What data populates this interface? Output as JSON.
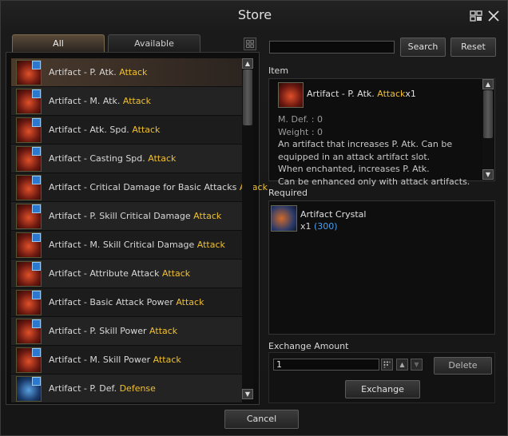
{
  "window": {
    "title": "Store"
  },
  "tabs": [
    {
      "label": "All"
    },
    {
      "label": "Available"
    }
  ],
  "items": [
    {
      "name": "Artifact - P. Atk.",
      "tag": "Attack"
    },
    {
      "name": "Artifact - M. Atk.",
      "tag": "Attack"
    },
    {
      "name": "Artifact - Atk. Spd.",
      "tag": "Attack"
    },
    {
      "name": "Artifact - Casting Spd.",
      "tag": "Attack"
    },
    {
      "name": "Artifact - Critical Damage for Basic Attacks",
      "tag": "Attack"
    },
    {
      "name": "Artifact - P. Skill Critical Damage",
      "tag": "Attack"
    },
    {
      "name": "Artifact - M. Skill Critical Damage",
      "tag": "Attack"
    },
    {
      "name": "Artifact - Attribute Attack",
      "tag": "Attack"
    },
    {
      "name": "Artifact - Basic Attack Power",
      "tag": "Attack"
    },
    {
      "name": "Artifact - P. Skill Power",
      "tag": "Attack"
    },
    {
      "name": "Artifact - M. Skill Power",
      "tag": "Attack"
    },
    {
      "name": "Artifact - P. Def.",
      "tag": "Defense"
    }
  ],
  "search": {
    "button": "Search",
    "reset": "Reset",
    "value": ""
  },
  "detail": {
    "section_label": "Item",
    "name": "Artifact - P. Atk.",
    "tag": "Attack",
    "qty": "x1",
    "mdef": "M. Def. : 0",
    "weight": "Weight : 0",
    "desc1": "An artifact that increases P. Atk. Can be equipped in an attack artifact slot.",
    "desc2": "When enchanted, increases P. Atk.",
    "desc3": "Can be enhanced only with attack artifacts. Max"
  },
  "required": {
    "section_label": "Required",
    "name": "Artifact Crystal",
    "qty": "x1",
    "owned": "(300)"
  },
  "exchange": {
    "section_label": "Exchange Amount",
    "amount": "1",
    "delete": "Delete",
    "exchange": "Exchange"
  },
  "footer": {
    "cancel": "Cancel"
  },
  "colors": {
    "accent_attack": "#f0c030",
    "accent_owned": "#4aa0f0"
  }
}
